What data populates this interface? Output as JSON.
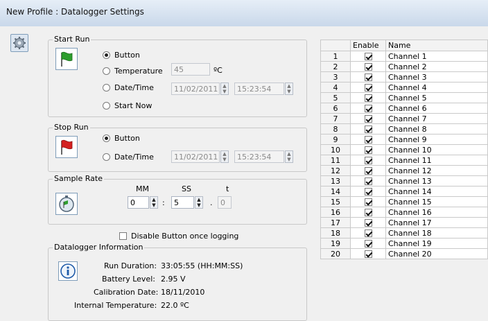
{
  "window": {
    "title": "New Profile : Datalogger Settings"
  },
  "start_run": {
    "legend": "Start Run",
    "options": [
      {
        "label": "Button",
        "selected": true
      },
      {
        "label": "Temperature",
        "selected": false
      },
      {
        "label": "Date/Time",
        "selected": false
      },
      {
        "label": "Start Now",
        "selected": false
      }
    ],
    "temperature_value": "45",
    "temperature_unit": "ºC",
    "date_value": "11/02/2011",
    "time_value": "15:23:54"
  },
  "stop_run": {
    "legend": "Stop Run",
    "options": [
      {
        "label": "Button",
        "selected": true
      },
      {
        "label": "Date/Time",
        "selected": false
      }
    ],
    "date_value": "11/02/2011",
    "time_value": "15:23:54"
  },
  "sample_rate": {
    "legend": "Sample Rate",
    "mm_label": "MM",
    "ss_label": "SS",
    "t_label": "t",
    "mm_value": "0",
    "ss_value": "5",
    "t_value": "0",
    "sep_colon": ":",
    "sep_dot": "."
  },
  "disable_button": {
    "label": "Disable Button once logging",
    "checked": false
  },
  "datalogger_info": {
    "legend": "Datalogger Information",
    "rows": [
      {
        "label": "Run Duration:",
        "value": "33:05:55 (HH:MM:SS)"
      },
      {
        "label": "Battery Level:",
        "value": "2.95 V"
      },
      {
        "label": "Calibration Date:",
        "value": "18/11/2010"
      },
      {
        "label": "Internal Temperature:",
        "value": "22.0 ºC"
      }
    ]
  },
  "channels": {
    "headers": {
      "num": "",
      "enable": "Enable",
      "name": "Name"
    },
    "rows": [
      {
        "num": "1",
        "enabled": true,
        "name": "Channel 1"
      },
      {
        "num": "2",
        "enabled": true,
        "name": "Channel 2"
      },
      {
        "num": "3",
        "enabled": true,
        "name": "Channel 3"
      },
      {
        "num": "4",
        "enabled": true,
        "name": "Channel 4"
      },
      {
        "num": "5",
        "enabled": true,
        "name": "Channel 5"
      },
      {
        "num": "6",
        "enabled": true,
        "name": "Channel 6"
      },
      {
        "num": "7",
        "enabled": true,
        "name": "Channel 7"
      },
      {
        "num": "8",
        "enabled": true,
        "name": "Channel 8"
      },
      {
        "num": "9",
        "enabled": true,
        "name": "Channel 9"
      },
      {
        "num": "10",
        "enabled": true,
        "name": "Channel 10"
      },
      {
        "num": "11",
        "enabled": true,
        "name": "Channel 11"
      },
      {
        "num": "12",
        "enabled": true,
        "name": "Channel 12"
      },
      {
        "num": "13",
        "enabled": true,
        "name": "Channel 13"
      },
      {
        "num": "14",
        "enabled": true,
        "name": "Channel 14"
      },
      {
        "num": "15",
        "enabled": true,
        "name": "Channel 15"
      },
      {
        "num": "16",
        "enabled": true,
        "name": "Channel 16"
      },
      {
        "num": "17",
        "enabled": true,
        "name": "Channel 17"
      },
      {
        "num": "18",
        "enabled": true,
        "name": "Channel 18"
      },
      {
        "num": "19",
        "enabled": true,
        "name": "Channel 19"
      },
      {
        "num": "20",
        "enabled": true,
        "name": "Channel 20"
      }
    ]
  },
  "colors": {
    "start_flag": "#2e9e2e",
    "stop_flag": "#d42020",
    "accent": "#1e5aa8"
  }
}
